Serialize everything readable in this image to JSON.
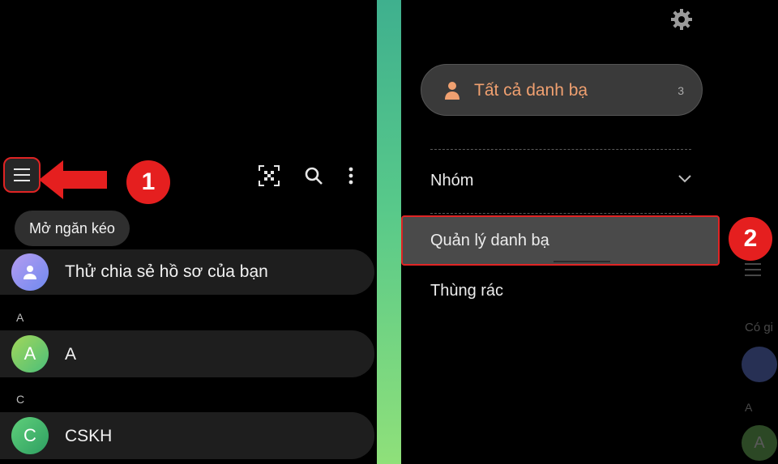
{
  "left": {
    "tooltip": "Mở ngăn kéo",
    "share_profile": "Thử chia sẻ hồ sơ của bạn",
    "sections": [
      {
        "letter": "A",
        "avatar": "A",
        "name": "A",
        "color": "#7fcf6a"
      },
      {
        "letter": "C",
        "avatar": "C",
        "name": "CSKH",
        "color": "#3fae6b"
      }
    ],
    "icons": [
      "menu-icon",
      "qr-scan-icon",
      "search-icon",
      "more-vert-icon"
    ],
    "step_badge": "1"
  },
  "right": {
    "all_contacts_label": "Tất cả danh bạ",
    "all_contacts_count": "3",
    "menu_items": [
      "Nhóm",
      "Quản lý danh bạ",
      "Thùng rác"
    ],
    "step_badge": "2",
    "faded_text": "Có gi",
    "faded_letter": "A",
    "faded_avatar": "A"
  },
  "colors": {
    "accent": "#f0a070",
    "highlight_border": "#e02424",
    "badge": "#e51f1f"
  }
}
